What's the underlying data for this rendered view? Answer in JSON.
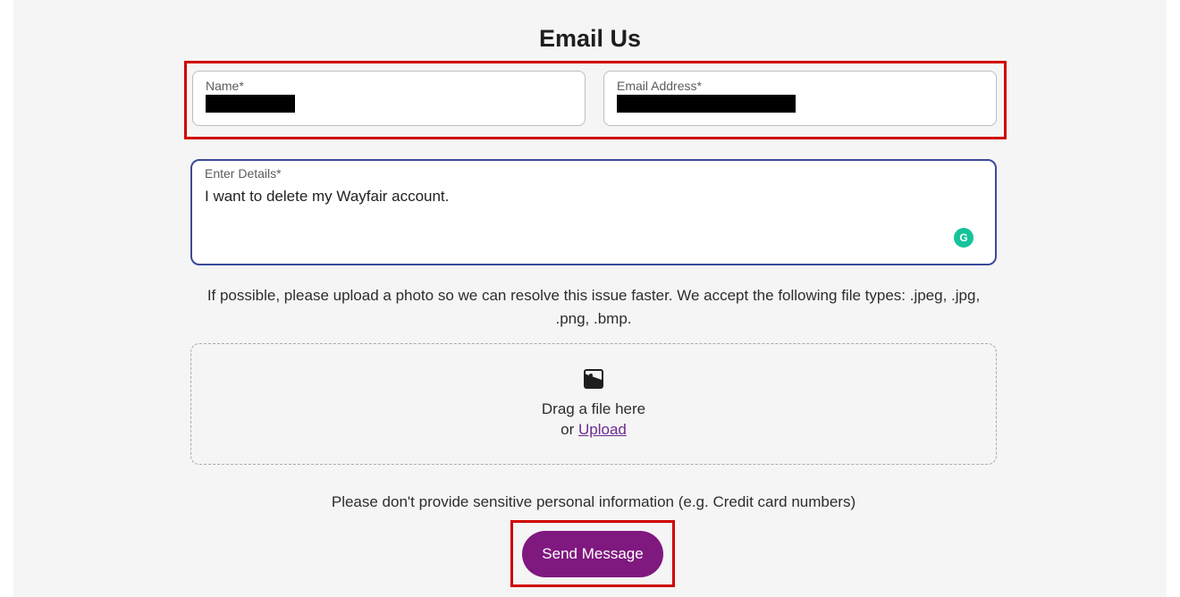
{
  "header": {
    "title": "Email Us"
  },
  "form": {
    "name": {
      "label": "Name*",
      "value": ""
    },
    "email": {
      "label": "Email Address*",
      "value": ""
    },
    "details": {
      "label": "Enter Details*",
      "value": "I want to delete my Wayfair account."
    }
  },
  "uploadHint": "If possible, please upload a photo so we can resolve this issue faster. We accept the following file types: .jpeg, .jpg, .png, .bmp.",
  "uploadZone": {
    "dragLine": "Drag a file here",
    "orWord": "or ",
    "uploadLink": "Upload"
  },
  "sensitiveNote": "Please don't provide sensitive personal information (e.g. Credit card numbers)",
  "sendButton": "Send Message",
  "grammarly": "G"
}
